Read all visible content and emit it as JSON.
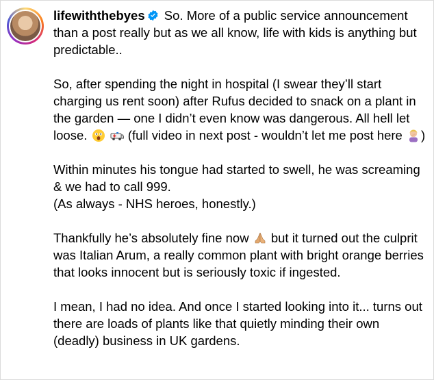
{
  "post": {
    "username": "lifewiththebyes",
    "caption_lines": {
      "p1": "So. More of a public service announcement than a post really but as we all know, life with kids is anything but predictable..",
      "p2a": "So, after spending the night in hospital (I swear they’ll start charging us rent soon) after Rufus decided to snack on a plant in the garden — one I didn’t even know was dangerous. All hell let loose.",
      "p2b": "(full video in next post - wouldn’t let me post here",
      "p2c": ")",
      "p3a": "Within minutes his tongue had started to swell, he was screaming & we had to call 999.",
      "p3b": "(As always - NHS heroes, honestly.)",
      "p4a": "Thankfully he’s absolutely fine now",
      "p4b": "but it turned out the culprit was Italian Arum, a really common plant with bright orange berries that looks innocent but is seriously toxic if ingested.",
      "p5": "I mean, I had no idea. And once I started looking into it... turns out there are loads of plants like that quietly minding their own (deadly) business in UK gardens."
    },
    "icons": {
      "verified": "verified-badge-icon",
      "emoji1": "astonished-face-emoji",
      "emoji2": "ambulance-emoji",
      "emoji3": "person-facepalming-emoji",
      "emoji4": "folded-hands-emoji"
    },
    "colors": {
      "verified": "#0095f6"
    }
  }
}
